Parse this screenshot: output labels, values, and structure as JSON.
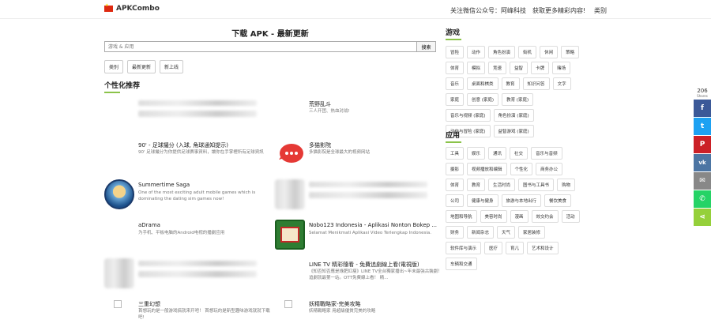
{
  "header": {
    "brand": "APKCombo",
    "wechat": "关注微信公众号：阿峰科技",
    "more": "获取更多精彩内容!",
    "category": "类别"
  },
  "main": {
    "title": "下载 APK - 最新更新",
    "search_placeholder": "游戏 & 应用",
    "search_button": "搜索",
    "pills": [
      "类别",
      "最新更新",
      "新上线"
    ],
    "section_title": "个性化推荐"
  },
  "apps": [
    {
      "name": "",
      "desc": ""
    },
    {
      "name": "荒野乱斗",
      "desc": "三人开团、热血对战!"
    },
    {
      "name": "90' - 足球撮分 (入球, 角球通知提示)",
      "desc": "90' 足球撮分为你提供足球赛事資料，讓你在手掌裡所有足球資訊"
    },
    {
      "name": "多猫影院",
      "desc": "多猫影院是全球最大的视频网站"
    },
    {
      "name": "Summertime Saga",
      "desc": "One of the most exciting adult mobile games which is dominating the dating sim games now!"
    },
    {
      "name": "",
      "desc": ""
    },
    {
      "name": "aDrama",
      "desc": "为手机、平板电脑的Android电视的播劇应用"
    },
    {
      "name": "Nobo123 Indonesia - Aplikasi Nonton Bokep ...",
      "desc": "Selamat Menikmati Aplikasi Video Terlengkap Indonesia."
    },
    {
      "name": "",
      "desc": ""
    },
    {
      "name": "LINE TV 精彩隨看 - 免費追劇線上看(電視版)",
      "desc": "《知否知否應是綠肥紅瘦》LINE TV全台獨家播出~年末最強古裝劇！ 追劇就最第一站。OTT免費線上看！ 精..."
    },
    {
      "name": "三重幻想",
      "desc": "首想玩的是一般游戏搞就来开吧！ 首想玩的是新型趣味游戏就就下载吧!"
    },
    {
      "name": "妖精戰略家-完美攻略",
      "desc": "妖精戰略家 用超級優質完美的攻略"
    }
  ],
  "games": {
    "title": "游戏",
    "tags": [
      "冒险",
      "动作",
      "角色扮演",
      "街机",
      "休闲",
      "策略",
      "体育",
      "模拟",
      "竞速",
      "益智",
      "卡牌",
      "赌场",
      "音乐",
      "桌面和棋类",
      "教育",
      "知识问答",
      "文字",
      "家庭",
      "创意 (家庭)",
      "教育 (家庭)",
      "音乐与视频 (家庭)",
      "角色扮演 (家庭)",
      "动作与冒险 (家庭)",
      "益智游戏 (家庭)"
    ]
  },
  "apps_section": {
    "title": "应用",
    "tags": [
      "工具",
      "娱乐",
      "通讯",
      "社交",
      "音乐与音频",
      "摄影",
      "视频播放和编辑",
      "个性化",
      "商务办公",
      "体育",
      "教育",
      "生活时尚",
      "图书与工具书",
      "购物",
      "公司",
      "健康与健身",
      "旅游与本地出行",
      "餐饮美食",
      "地图和导航",
      "美容时尚",
      "漫画",
      "效交约会",
      "活动",
      "财务",
      "新闻杂志",
      "天气",
      "家居装修",
      "软件库与演示",
      "医疗",
      "育儿",
      "艺术和设计",
      "车辆和交通"
    ]
  },
  "share": {
    "count": "206",
    "label": "Shares"
  },
  "colors": {
    "accent": "#8bc34a",
    "facebook": "#3b5998",
    "twitter": "#1da1f2",
    "pinterest": "#cb2027",
    "vk": "#4c75a3",
    "email": "#888888",
    "whatsapp": "#25d366",
    "sharethis": "#95d03a"
  }
}
